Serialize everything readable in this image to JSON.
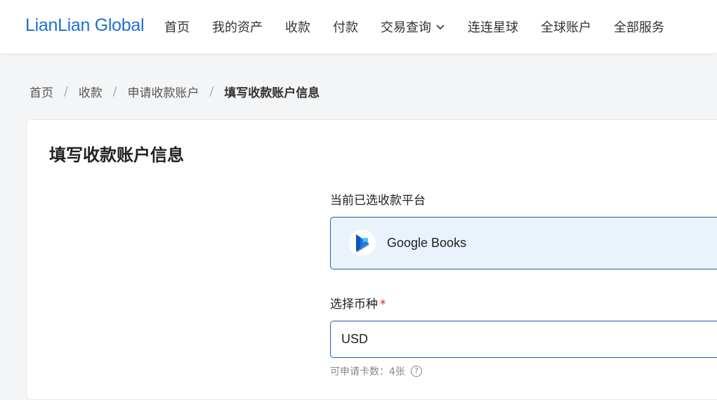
{
  "brand": {
    "logo_text": "LianLian Global",
    "accent_color": "#1f6fd1"
  },
  "nav": {
    "items": [
      {
        "label": "首页"
      },
      {
        "label": "我的资产"
      },
      {
        "label": "收款"
      },
      {
        "label": "付款"
      },
      {
        "label": "交易查询",
        "has_dropdown": true
      },
      {
        "label": "连连星球"
      },
      {
        "label": "全球账户"
      },
      {
        "label": "全部服务"
      }
    ]
  },
  "breadcrumb": {
    "items": [
      "首页",
      "收款",
      "申请收款账户"
    ],
    "separator": "/",
    "current": "填写收款账户信息"
  },
  "card": {
    "title": "填写收款账户信息",
    "platform_label": "当前已选收款平台",
    "platform_name": "Google Books",
    "platform_icon": "google-books-icon",
    "currency_label": "选择币种",
    "required_mark": "*",
    "currency_value": "USD",
    "hint_text": "可申请卡数：4张",
    "hint_icon": "help-circle-icon"
  }
}
